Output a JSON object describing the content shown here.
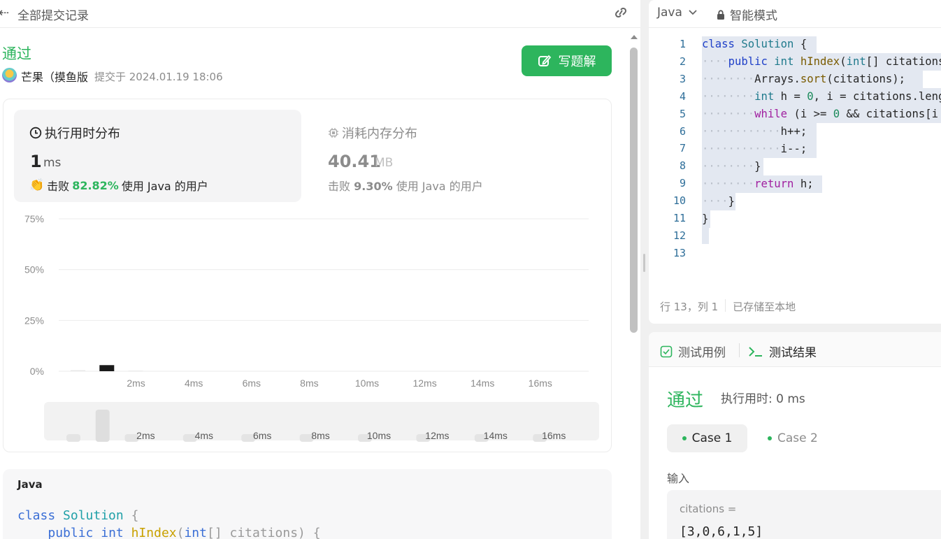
{
  "left_header": {
    "back_label": "全部提交记录"
  },
  "submission": {
    "status": "通过",
    "user": "芒果（摸鱼版",
    "submitted_at": "提交于 2024.01.19 18:06",
    "write_solution_label": "写题解"
  },
  "runtime": {
    "title": "执行用时分布",
    "value": "1",
    "unit": "ms",
    "beat_prefix": "击败",
    "beat_pct": "82.82%",
    "beat_suffix": "使用 Java 的用户"
  },
  "memory": {
    "title": "消耗内存分布",
    "value": "40.41",
    "unit": "MB",
    "beat_prefix": "击败",
    "beat_pct": "9.30%",
    "beat_suffix": "使用 Java 的用户"
  },
  "chart_data": {
    "type": "bar",
    "y_ticks": [
      "75%",
      "50%",
      "25%",
      "0%"
    ],
    "ylim": [
      0,
      75
    ],
    "x_ticks": [
      "2ms",
      "4ms",
      "6ms",
      "8ms",
      "10ms",
      "12ms",
      "14ms",
      "16ms"
    ],
    "bins_ms": [
      0,
      1,
      2
    ],
    "values": [
      0.5,
      3,
      0.3
    ],
    "highlight_bin": 1,
    "overview_ticks": [
      "2ms",
      "4ms",
      "6ms",
      "8ms",
      "10ms",
      "12ms",
      "14ms",
      "16ms"
    ],
    "colors": {
      "highlight": "#1a1a1a",
      "other": "#e8e8e8",
      "grid": "#ebebeb"
    }
  },
  "code_preview": {
    "lang": "Java",
    "line1": {
      "kw": "class",
      "name": "Solution",
      "brace": "{"
    },
    "line2": {
      "kw": "public",
      "ty": "int",
      "fn": "hIndex",
      "paren": "(",
      "ty2": "int",
      "rest": "[] citations) {"
    }
  },
  "editor": {
    "language": "Java",
    "mode": "智能模式",
    "line_numbers": [
      "1",
      "2",
      "3",
      "4",
      "5",
      "6",
      "7",
      "8",
      "9",
      "10",
      "11",
      "12",
      "13"
    ],
    "status_pos": "行 13，列 1",
    "status_saved": "已存储至本地"
  },
  "result_panel": {
    "tab_testcase": "测试用例",
    "tab_result": "测试结果",
    "status": "通过",
    "time": "执行用时: 0 ms",
    "case1": "Case 1",
    "case2": "Case 2",
    "input_label": "输入",
    "param_name": "citations =",
    "param_value": "[3,0,6,1,5]"
  },
  "colors": {
    "accent_green": "#2db55d"
  }
}
